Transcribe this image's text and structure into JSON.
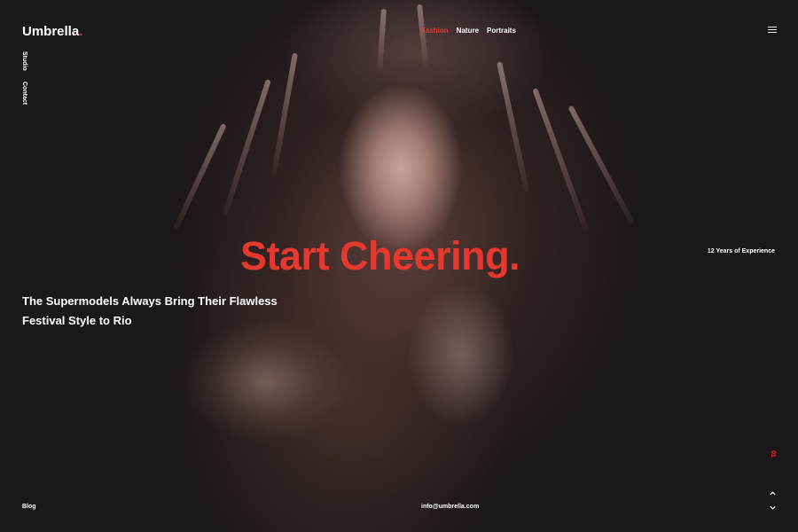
{
  "brand": {
    "name": "Umbrella",
    "dot": ".",
    "accent_color": "#e6382c"
  },
  "nav": {
    "items": [
      {
        "label": "Fashion",
        "active": true
      },
      {
        "label": "Nature",
        "active": false
      },
      {
        "label": "Portraits",
        "active": false
      }
    ],
    "menu_icon": "hamburger-icon"
  },
  "side_nav": {
    "items": [
      "Studio",
      "Contact"
    ]
  },
  "hero": {
    "headline": "Start Cheering.",
    "tagline_line1": "The Supermodels Always Bring Their Flawless",
    "tagline_line2": "Festival Style to Rio",
    "experience": "12 Years of Experience",
    "slide_number": "01"
  },
  "footer": {
    "blog": "Blog",
    "email": "info@umbrella.com",
    "prev_icon": "chevron-up-icon",
    "next_icon": "chevron-down-icon"
  }
}
